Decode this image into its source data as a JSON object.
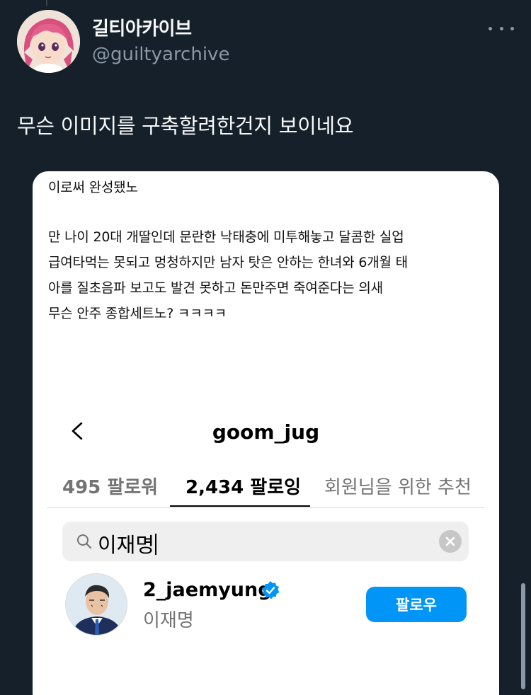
{
  "tweet": {
    "display_name": "길티아카이브",
    "handle": "@guiltyarchive",
    "text": "무슨 이미지를 구축할려한건지 보이네요"
  },
  "media": {
    "caption_lines": [
      "이로써 완성됐노",
      "만 나이 20대 개딸인데 문란한 낙태충에 미투해놓고 달콤한 실업",
      "급여타먹는 못되고 멍청하지만 남자 탓은 안하는 한녀와 6개월 태",
      "아를 질초음파 보고도 발견 못하고 돈만주면 죽여준다는 의새",
      "무슨 안주 종합세트노? ㅋㅋㅋㅋ"
    ],
    "instagram": {
      "title": "goom_jug",
      "tabs": [
        {
          "label": "495 팔로워"
        },
        {
          "label": "2,434 팔로잉"
        },
        {
          "label": "회원님을 위한 추천"
        }
      ],
      "search_value": "이재명",
      "result": {
        "username": "2_jaemyung",
        "full_name": "이재명",
        "follow_label": "팔로우"
      }
    }
  },
  "colors": {
    "background": "#15202b",
    "accent": "#0095f6",
    "verified": "#0095f6"
  }
}
